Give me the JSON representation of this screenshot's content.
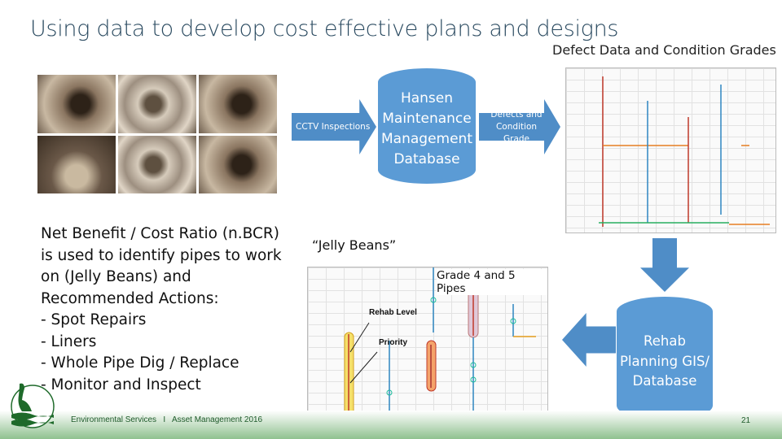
{
  "title": "Using data to develop cost effective plans and designs",
  "defect_heading": "Defect Data and Condition Grades",
  "flow": {
    "cctv": "CCTV Inspections",
    "hansen": "Hansen Maintenance Management Database",
    "defects": "Defects and Condition Grade",
    "rehab_db": "Rehab Planning GIS/ Database"
  },
  "jelly_beans": "“Jelly Beans”",
  "map": {
    "grade_label": "Grade 4 and 5 Pipes",
    "rehab_level": "Rehab Level",
    "priority": "Priority"
  },
  "body": {
    "intro": "Net Benefit / Cost Ratio (n.BCR) is used to identify pipes to work on (Jelly Beans) and Recommended Actions:",
    "items": [
      "-  Spot Repairs",
      "-  Liners",
      "-  Whole Pipe Dig / Replace",
      "-  Monitor and Inspect"
    ]
  },
  "footer": {
    "text": "Environmental Services   I   Asset Management 2016",
    "page": "21"
  },
  "colors": {
    "blue": "#5b9bd5",
    "green": "#1e5a2a"
  }
}
